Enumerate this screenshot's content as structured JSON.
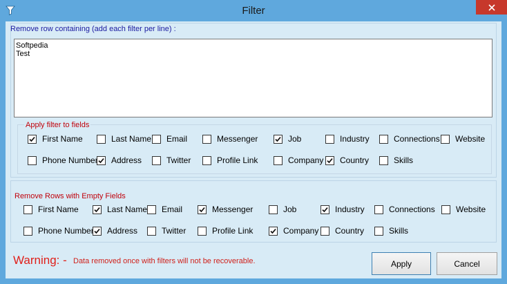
{
  "window": {
    "title": "Filter"
  },
  "remove_row": {
    "label": "Remove row containing (add each filter per line) :",
    "lines": [
      "Softpedia",
      "Test"
    ]
  },
  "apply_fields": {
    "group_label": "Apply filter to fields",
    "row1": [
      {
        "label": "First Name",
        "checked": true
      },
      {
        "label": "Last Name",
        "checked": false
      },
      {
        "label": "Email",
        "checked": false
      },
      {
        "label": "Messenger",
        "checked": false
      },
      {
        "label": "Job",
        "checked": true
      },
      {
        "label": "Industry",
        "checked": false
      },
      {
        "label": "Connections",
        "checked": false
      },
      {
        "label": "Website",
        "checked": false
      }
    ],
    "row2": [
      {
        "label": "Phone Number",
        "checked": false
      },
      {
        "label": "Address",
        "checked": true
      },
      {
        "label": "Twitter",
        "checked": false
      },
      {
        "label": "Profile Link",
        "checked": false
      },
      {
        "label": "Company",
        "checked": false
      },
      {
        "label": "Country",
        "checked": true
      },
      {
        "label": "Skills",
        "checked": false
      }
    ]
  },
  "empty_fields": {
    "label": "Remove Rows with Empty Fields",
    "row1": [
      {
        "label": "First Name",
        "checked": false
      },
      {
        "label": "Last Name",
        "checked": true
      },
      {
        "label": "Email",
        "checked": false
      },
      {
        "label": "Messenger",
        "checked": true
      },
      {
        "label": "Job",
        "checked": false
      },
      {
        "label": "Industry",
        "checked": true
      },
      {
        "label": "Connections",
        "checked": false
      },
      {
        "label": "Website",
        "checked": false
      }
    ],
    "row2": [
      {
        "label": "Phone Number",
        "checked": false
      },
      {
        "label": "Address",
        "checked": true
      },
      {
        "label": "Twitter",
        "checked": false
      },
      {
        "label": "Profile Link",
        "checked": false
      },
      {
        "label": "Company",
        "checked": true
      },
      {
        "label": "Country",
        "checked": false
      },
      {
        "label": "Skills",
        "checked": false
      }
    ]
  },
  "warning": {
    "title": "Warning: -",
    "text": "Data removed once with filters will not be recoverable."
  },
  "buttons": {
    "apply": "Apply",
    "cancel": "Cancel"
  },
  "colors": {
    "title_bar": "#5fa8dd",
    "client_bg": "#d8ebf6",
    "close_button": "#c7382b",
    "warning": "#e0201a",
    "section_label_blue": "#1a1aa0",
    "section_label_red": "#c0000a"
  },
  "icons": {
    "app": "filter-funnel-icon",
    "close": "close-x-icon",
    "check": "checkmark-icon"
  }
}
